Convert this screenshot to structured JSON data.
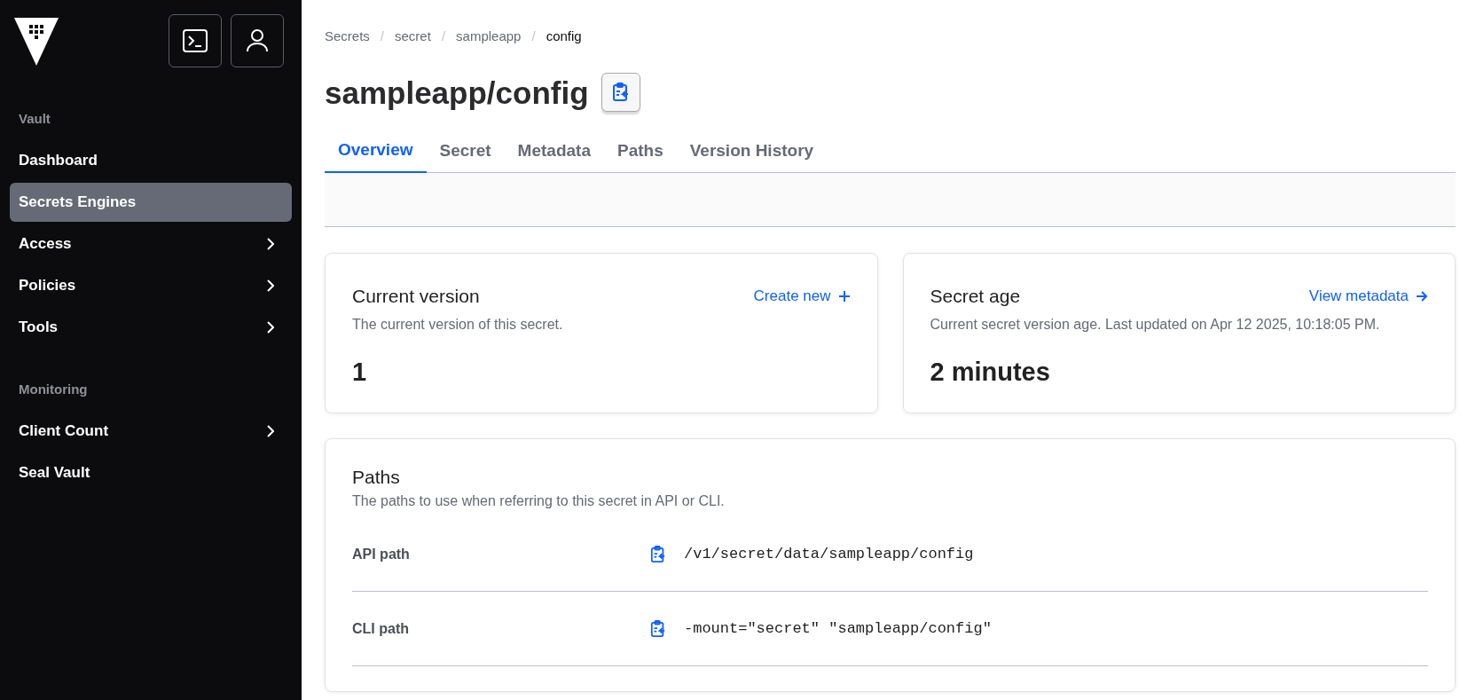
{
  "sidebar": {
    "sections": [
      {
        "heading": "Vault",
        "items": [
          {
            "label": "Dashboard",
            "selected": false,
            "has_submenu": false
          },
          {
            "label": "Secrets Engines",
            "selected": true,
            "has_submenu": false
          },
          {
            "label": "Access",
            "selected": false,
            "has_submenu": true
          },
          {
            "label": "Policies",
            "selected": false,
            "has_submenu": true
          },
          {
            "label": "Tools",
            "selected": false,
            "has_submenu": true
          }
        ]
      },
      {
        "heading": "Monitoring",
        "items": [
          {
            "label": "Client Count",
            "selected": false,
            "has_submenu": true
          },
          {
            "label": "Seal Vault",
            "selected": false,
            "has_submenu": false
          }
        ]
      }
    ]
  },
  "breadcrumbs": [
    {
      "label": "Secrets"
    },
    {
      "separator": "/",
      "label": "secret"
    },
    {
      "separator": "/",
      "label": "sampleapp"
    },
    {
      "separator": "/",
      "label": "config"
    }
  ],
  "title": "sampleapp/config",
  "tabs": [
    {
      "label": "Overview",
      "selected": true
    },
    {
      "label": "Secret",
      "selected": false
    },
    {
      "label": "Metadata",
      "selected": false
    },
    {
      "label": "Paths",
      "selected": false
    },
    {
      "label": "Version History",
      "selected": false
    }
  ],
  "cards": [
    {
      "title": "Current version",
      "link": "Create new",
      "kind": "create",
      "description": "The current version of this secret.",
      "value": "1"
    },
    {
      "title": "Secret age",
      "link": "View metadata",
      "kind": "navigate",
      "description": "Current secret version age. Last updated on Apr 12 2025, 10:18:05 PM.",
      "value": "2 minutes"
    }
  ],
  "paths": {
    "title": "Paths",
    "description": "The paths to use when referring to this secret in API or CLI.",
    "rows": [
      {
        "label": "API path",
        "value": "/v1/secret/data/sampleapp/config"
      },
      {
        "label": "CLI path",
        "value": "-mount=\"secret\" \"sampleapp/config\""
      }
    ]
  }
}
